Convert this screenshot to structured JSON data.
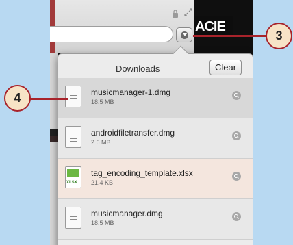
{
  "toolbar": {
    "brand_logo": "ACIE"
  },
  "downloads": {
    "title": "Downloads",
    "clear_label": "Clear",
    "items": [
      {
        "name": "musicmanager-1.dmg",
        "size": "18.5 MB",
        "type": "dmg"
      },
      {
        "name": "androidfiletransfer.dmg",
        "size": "2.6 MB",
        "type": "dmg"
      },
      {
        "name": "tag_encoding_template.xlsx",
        "size": "21.4 KB",
        "type": "xlsx"
      },
      {
        "name": "musicmanager.dmg",
        "size": "18.5 MB",
        "type": "dmg"
      }
    ]
  },
  "callouts": {
    "three": "3",
    "four": "4"
  },
  "colors": {
    "callout_border": "#a8232b",
    "callout_fill": "#f7e3c6",
    "background": "#b8d9f2"
  },
  "icons": [
    "lock-icon",
    "fullscreen-icon",
    "downloads-icon",
    "file-icon",
    "spreadsheet-file-icon",
    "magnifier-icon"
  ]
}
